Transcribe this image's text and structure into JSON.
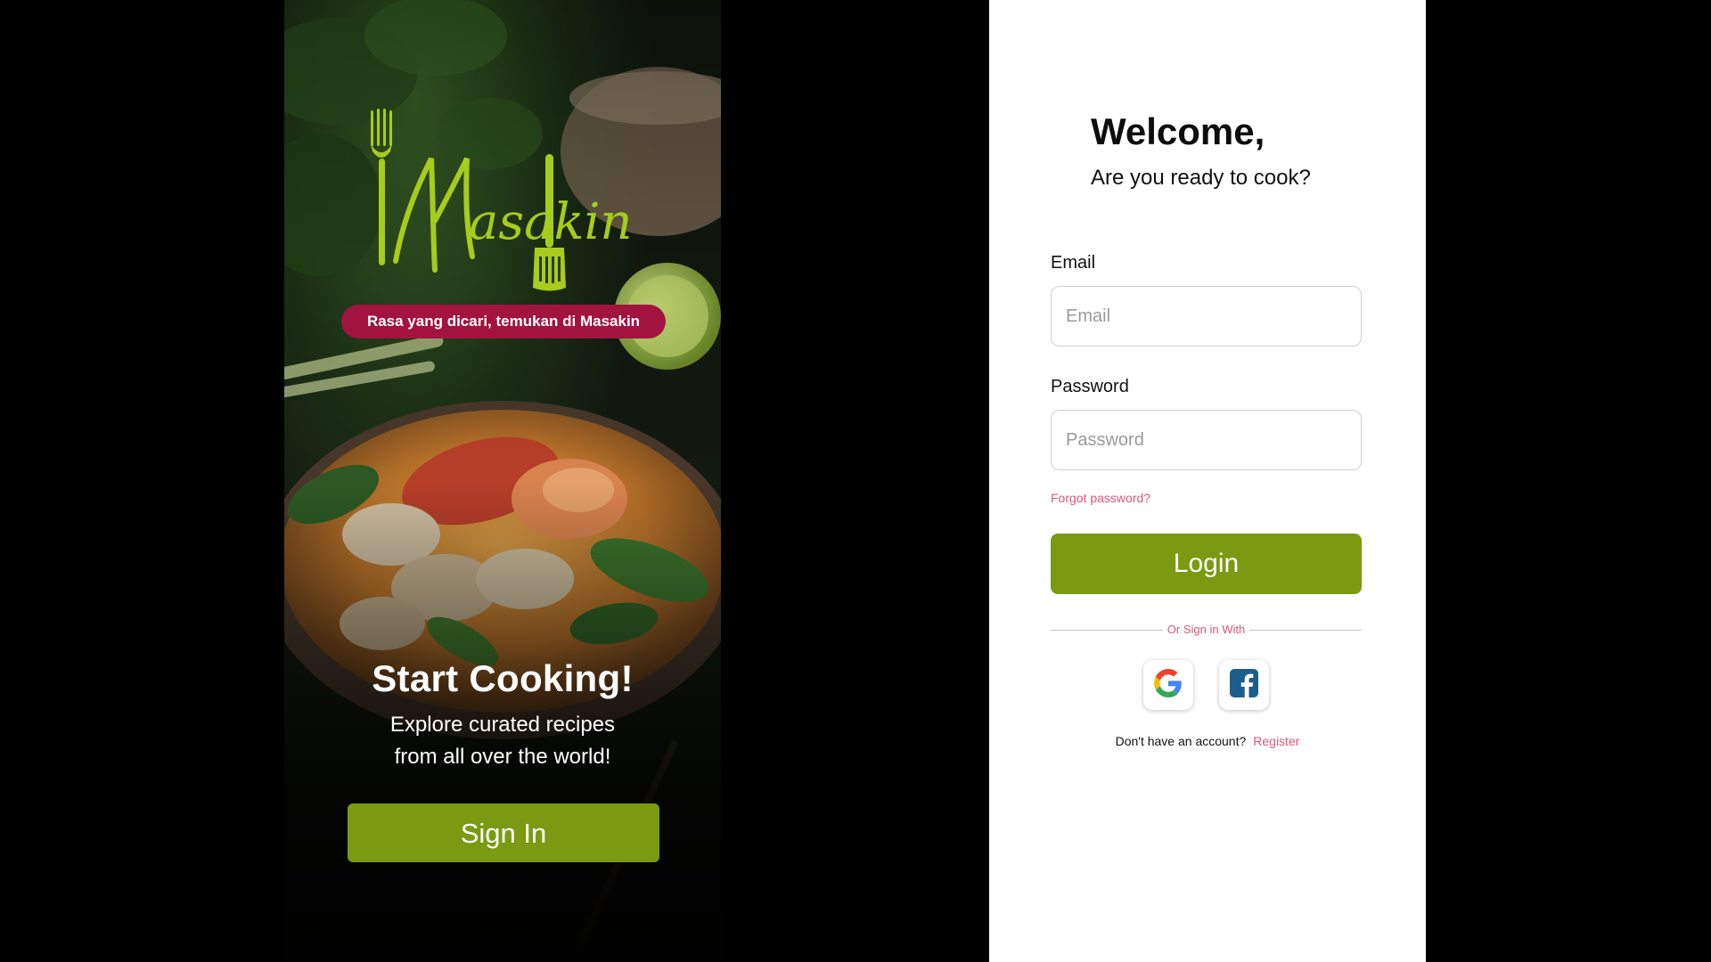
{
  "splash": {
    "logo_text": "Masakin",
    "tagline": "Rasa yang dicari, temukan di Masakin",
    "heading": "Start Cooking!",
    "subtitle_line1": "Explore curated recipes",
    "subtitle_line2": "from all over the world!",
    "sign_in_label": "Sign In"
  },
  "login": {
    "title": "Welcome,",
    "subtitle": "Are you ready to cook?",
    "email_label": "Email",
    "email_placeholder": "Email",
    "email_value": "",
    "password_label": "Password",
    "password_placeholder": "Password",
    "password_value": "",
    "forgot_label": "Forgot password?",
    "login_label": "Login",
    "divider_text": "Or Sign in With",
    "social": [
      {
        "name": "google",
        "icon": "google-icon"
      },
      {
        "name": "facebook",
        "icon": "facebook-icon"
      }
    ],
    "no_account_text": "Don't have an account?",
    "register_label": "Register"
  },
  "colors": {
    "brand_green": "#7a9a12",
    "logo_green": "#a6cc1c",
    "tagline_red": "#a3133f",
    "link_pink": "#e0557a",
    "background": "#000000"
  }
}
